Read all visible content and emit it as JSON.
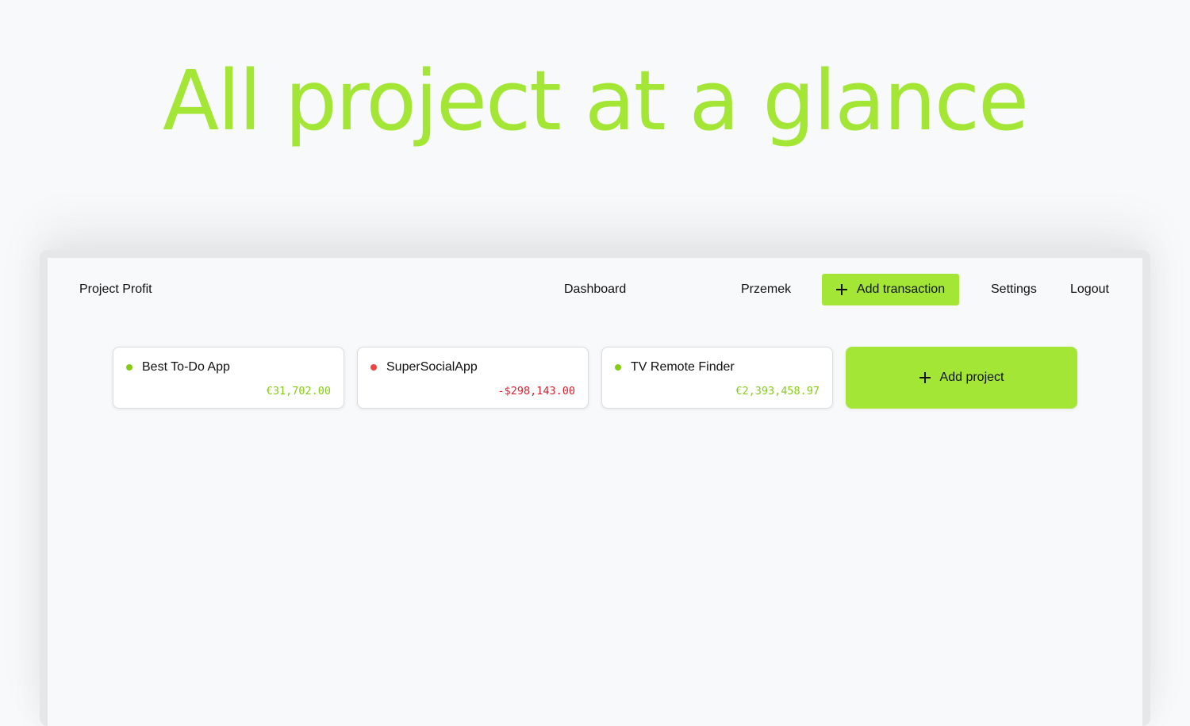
{
  "hero": {
    "title": "All project at a glance"
  },
  "nav": {
    "brand": "Project Profit",
    "dashboard": "Dashboard",
    "user": "Przemek",
    "add_transaction": "Add transaction",
    "settings": "Settings",
    "logout": "Logout"
  },
  "projects": [
    {
      "name": "Best To-Do App",
      "amount": "€31,702.00",
      "status": "positive"
    },
    {
      "name": "SuperSocialApp",
      "amount": "-$298,143.00",
      "status": "negative"
    },
    {
      "name": "TV Remote Finder",
      "amount": "€2,393,458.97",
      "status": "positive"
    }
  ],
  "add_project": {
    "label": "Add project"
  },
  "colors": {
    "accent": "#a3e635",
    "positive": "#84cc16",
    "negative": "#ef4444",
    "positive_text": "#84cc16",
    "negative_text": "#e11d2b"
  },
  "icons": {
    "add_transaction": "plus-icon",
    "add_project": "plus-icon",
    "status": "status-dot-icon"
  }
}
